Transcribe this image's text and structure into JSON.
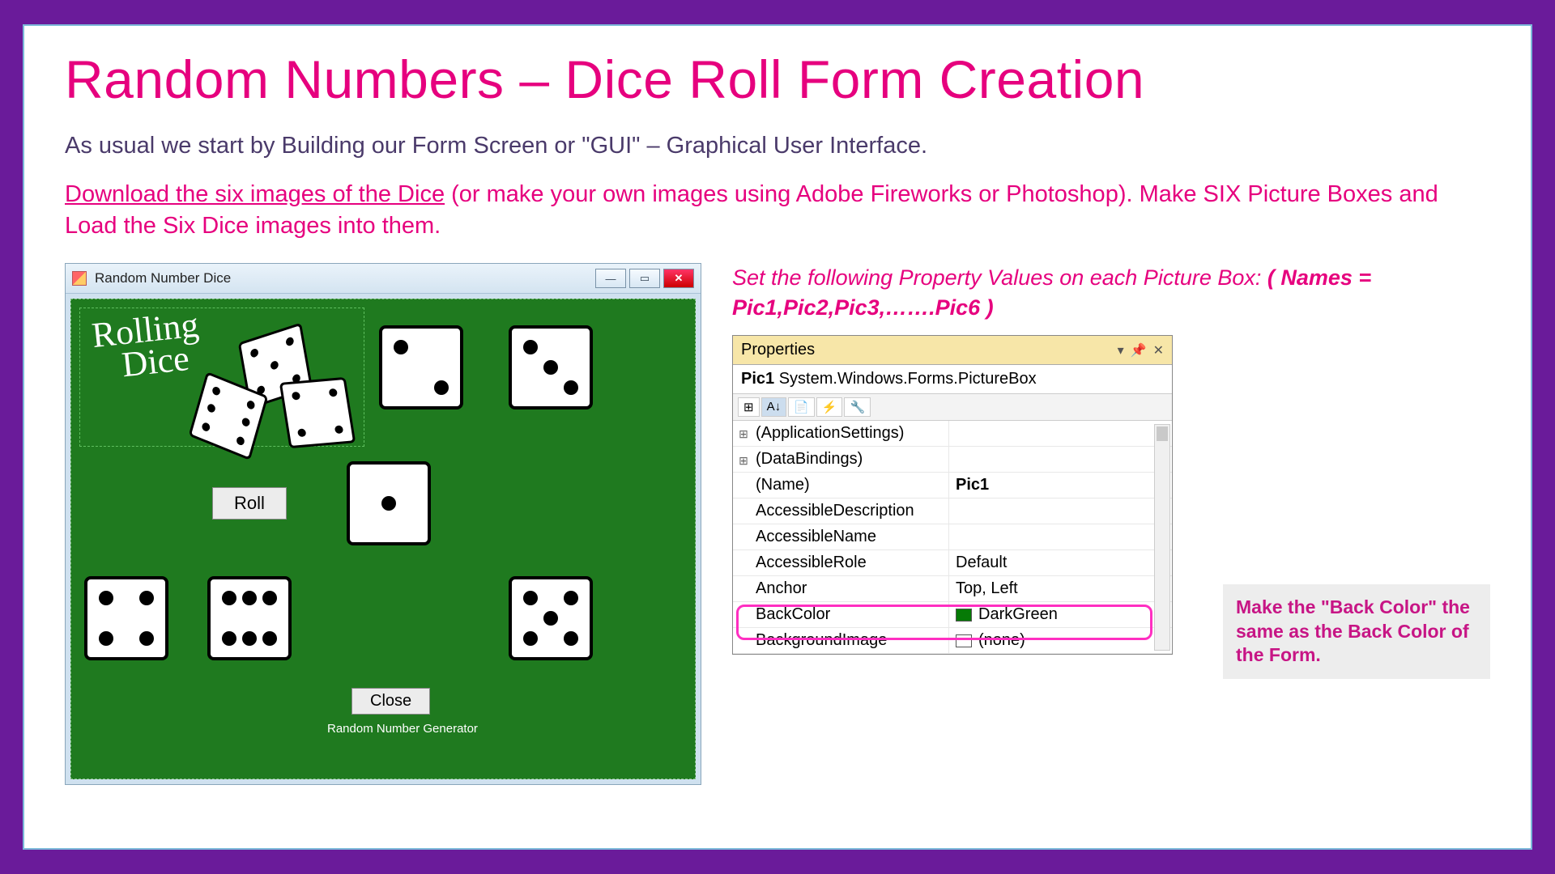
{
  "title": "Random Numbers – Dice Roll Form Creation",
  "intro": "As usual we start by Building our Form Screen or \"GUI\" – Graphical User Interface.",
  "link_text": "Download the six images of the Dice",
  "instr_rest": " (or make your own images using Adobe Fireworks or Photoshop). Make SIX Picture Boxes and Load the Six Dice images into them.",
  "window": {
    "title": "Random Number Dice",
    "logo1": "Rolling",
    "logo2": "Dice",
    "roll": "Roll",
    "close": "Close",
    "footer": "Random Number Generator"
  },
  "caption1": "Set the following Property Values on each Picture Box:  ",
  "caption2": "( Names = Pic1,Pic2,Pic3,…….Pic6 )",
  "props": {
    "header": "Properties",
    "component": "Pic1 System.Windows.Forms.PictureBox",
    "rows": [
      {
        "k": "(ApplicationSettings)",
        "v": "",
        "exp": "⊞"
      },
      {
        "k": "(DataBindings)",
        "v": "",
        "exp": "⊞"
      },
      {
        "k": "(Name)",
        "v": "Pic1",
        "bold": true
      },
      {
        "k": "AccessibleDescription",
        "v": ""
      },
      {
        "k": "AccessibleName",
        "v": ""
      },
      {
        "k": "AccessibleRole",
        "v": "Default"
      },
      {
        "k": "Anchor",
        "v": "Top, Left"
      },
      {
        "k": "BackColor",
        "v": "DarkGreen",
        "swatch": "green"
      },
      {
        "k": "BackgroundImage",
        "v": "(none)",
        "swatch": "none"
      }
    ]
  },
  "note": "Make the \"Back Color\" the same as the Back Color of the Form."
}
